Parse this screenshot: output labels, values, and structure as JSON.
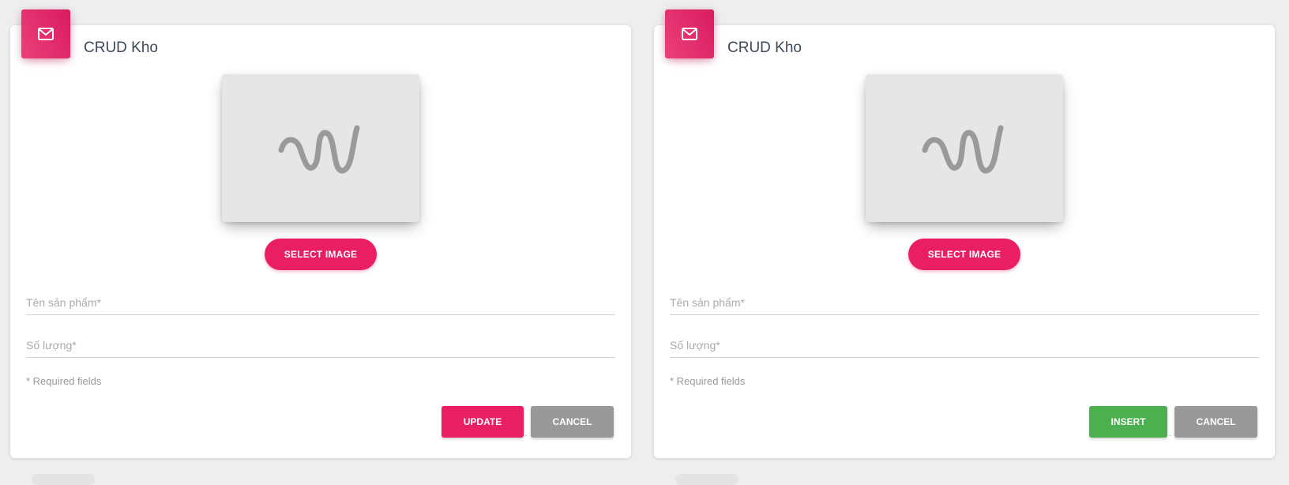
{
  "colors": {
    "page_background": "#eeeeee",
    "primary_pink": "#e91e63",
    "insert_green": "#4caf50",
    "cancel_gray": "#999999",
    "placeholder_frame": "#e6e6e6"
  },
  "cards": [
    {
      "header_icon": "mail-icon",
      "title": "CRUD Kho",
      "image_placeholder_icon": "image-placeholder-icon",
      "select_image_label": "SELECT IMAGE",
      "fields": {
        "name_placeholder": "Tên sản phẩm*",
        "name_value": "",
        "quantity_placeholder": "Số lượng*",
        "quantity_value": ""
      },
      "required_note": "* Required fields",
      "action_label": "UPDATE",
      "separator": ".",
      "cancel_label": "CANCEL"
    },
    {
      "header_icon": "mail-icon",
      "title": "CRUD Kho",
      "image_placeholder_icon": "image-placeholder-icon",
      "select_image_label": "SELECT IMAGE",
      "fields": {
        "name_placeholder": "Tên sản phẩm*",
        "name_value": "",
        "quantity_placeholder": "Số lượng*",
        "quantity_value": ""
      },
      "required_note": "* Required fields",
      "action_label": "INSERT",
      "separator": ".",
      "cancel_label": "CANCEL"
    }
  ]
}
